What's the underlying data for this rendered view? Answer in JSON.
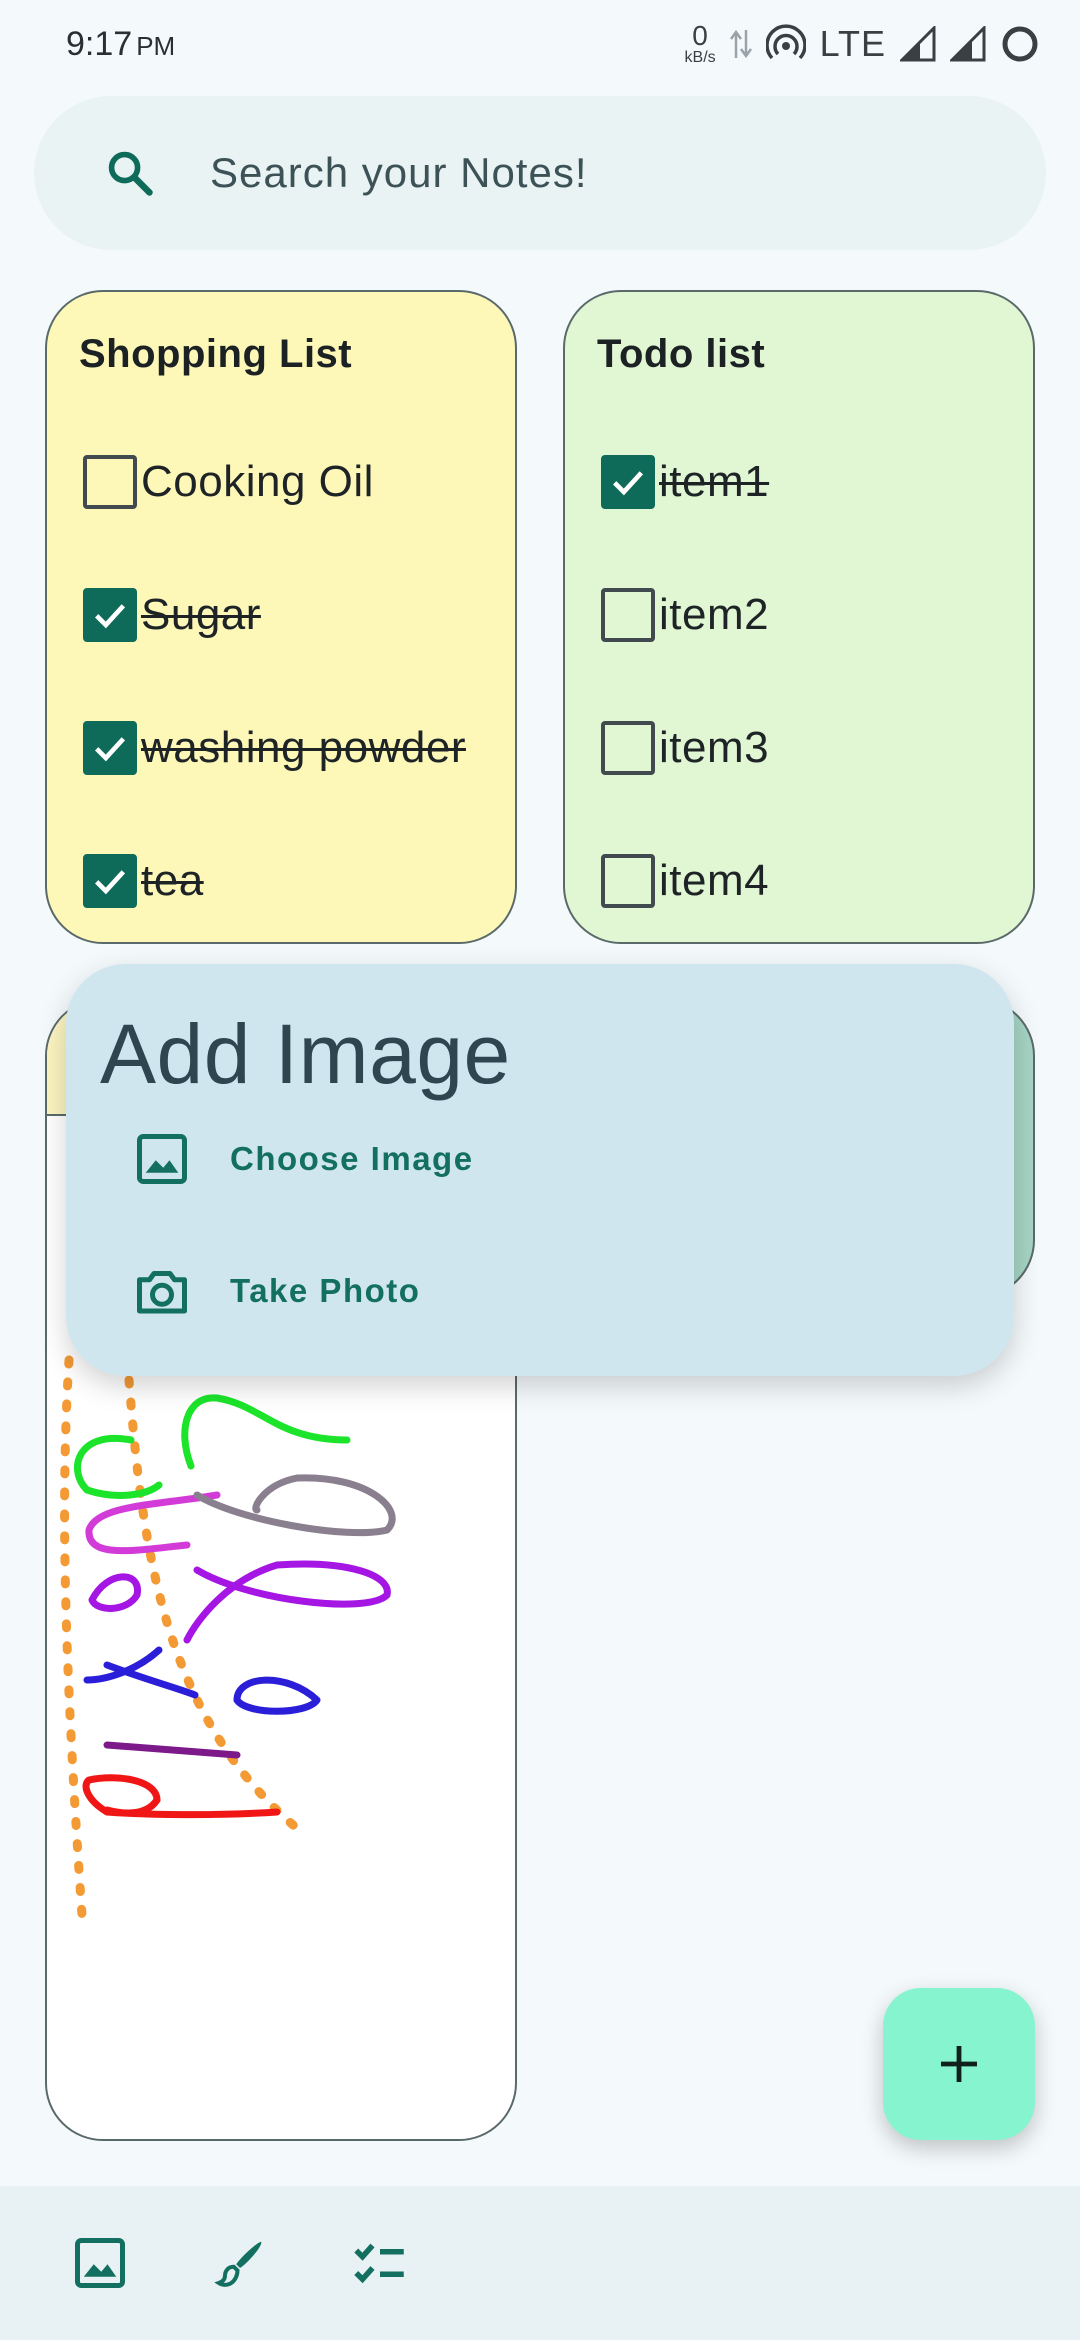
{
  "status_bar": {
    "time": "9:17",
    "ampm": "PM",
    "net_speed_value": "0",
    "net_speed_unit": "kB/s",
    "network_type": "LTE"
  },
  "search": {
    "placeholder": "Search your Notes!"
  },
  "notes": [
    {
      "title": "Shopping List",
      "color": "#fdf7b8",
      "items": [
        {
          "label": "Cooking Oil",
          "checked": false
        },
        {
          "label": "Sugar",
          "checked": true
        },
        {
          "label": "washing powder",
          "checked": true
        },
        {
          "label": "tea",
          "checked": true
        }
      ]
    },
    {
      "title": "Todo list",
      "color": "#e1f6d3",
      "items": [
        {
          "label": "item1",
          "checked": true
        },
        {
          "label": "item2",
          "checked": false
        },
        {
          "label": "item3",
          "checked": false
        },
        {
          "label": "item4",
          "checked": false
        }
      ]
    }
  ],
  "dialog": {
    "title": "Add Image",
    "options": [
      {
        "label": "Choose Image",
        "icon": "image-icon"
      },
      {
        "label": "Take Photo",
        "icon": "camera-icon"
      }
    ]
  },
  "fab": {
    "icon": "plus-icon"
  },
  "bottom_bar": {
    "icons": [
      "image-icon",
      "brush-icon",
      "checklist-icon"
    ]
  },
  "colors": {
    "accent": "#0e6b5a",
    "fab": "#86f5cf",
    "dialog": "#d0e6ef",
    "search": "#e9f3f4"
  }
}
